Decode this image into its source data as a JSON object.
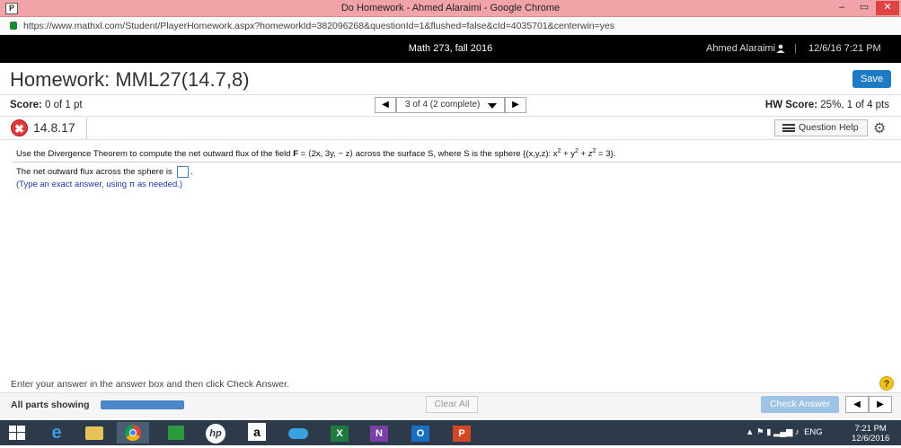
{
  "window": {
    "title": "Do Homework - Ahmed Alaraimi - Google Chrome",
    "app_icon": "P",
    "min": "–",
    "max": "▭",
    "close": "✕"
  },
  "address": {
    "url": "https://www.mathxl.com/Student/PlayerHomework.aspx?homeworkId=382096268&questionId=1&flushed=false&cId=4035701&centerwin=yes"
  },
  "topbar": {
    "course": "Math 273, fall 2016",
    "user": "Ahmed Alaraimi",
    "sep": "|",
    "datetime": "12/6/16 7:21 PM"
  },
  "header": {
    "title": "Homework: MML27(14.7,8)",
    "save_label": "Save"
  },
  "score": {
    "label": "Score:",
    "value": "0 of 1 pt",
    "nav_prev": "◀",
    "nav_next": "▶",
    "question_select": "3 of 4 (2 complete)",
    "hw_label": "HW Score:",
    "hw_value": "25%, 1 of 4 pts"
  },
  "question": {
    "number": "14.8.17",
    "status_icon": "✖",
    "help_label": "Question Help",
    "text_before": "Use the Divergence Theorem to compute the net outward flux of the field ",
    "field_bold": "F",
    "text_field": " = ⟨2x, 3y, − z⟩ across the surface S, where S is the sphere {(x,y,z): x",
    "sup1": "2",
    "plus1": " + y",
    "sup2": "2",
    "plus2": " + z",
    "sup3": "2",
    "text_end": " = 3}.",
    "answer_prompt": "The net outward flux across the sphere is",
    "answer_period": ".",
    "hint": "(Type an exact answer, using π as needed.)"
  },
  "footer": {
    "instructions": "Enter your answer in the answer box and then click Check Answer.",
    "help_icon": "?",
    "all_parts": "All parts showing",
    "clear_all": "Clear All",
    "check_answer": "Check Answer",
    "prev": "◀",
    "next": "▶"
  },
  "taskbar": {
    "tray_lang": "ENG",
    "clock_time": "7:21 PM",
    "clock_date": "12/6/2016"
  }
}
